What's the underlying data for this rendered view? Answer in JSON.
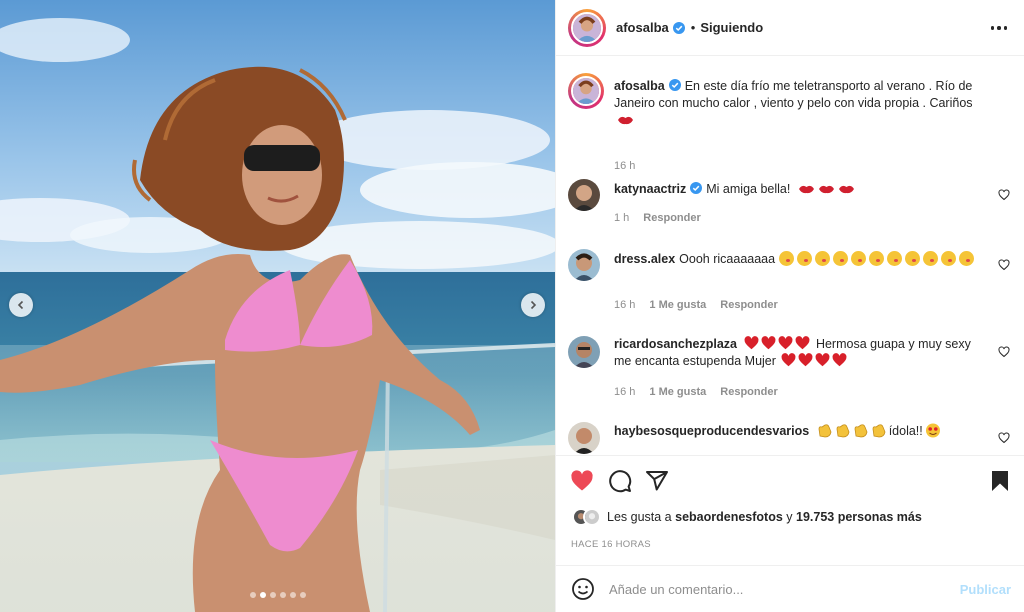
{
  "post": {
    "author": "afosalba",
    "follow_status": "Siguiendo",
    "separator": "•",
    "caption": "En este día frío me teletransporto al verano . Río de Janeiro con mucho calor , viento y pelo con vida propia . Cariños",
    "caption_time": "16 h"
  },
  "media": {
    "slides_count": 6,
    "active_slide": 2,
    "prev_icon": "chevron-left-icon",
    "next_icon": "chevron-right-icon"
  },
  "comments": [
    {
      "user": "katynaactriz",
      "verified": true,
      "text": "Mi amiga bella!",
      "time": "1 h",
      "likes": "",
      "reply": "Responder"
    },
    {
      "user": "dress.alex",
      "verified": false,
      "text": "Oooh ricaaaaaaa",
      "time": "16 h",
      "likes": "1 Me gusta",
      "reply": "Responder"
    },
    {
      "user": "ricardosanchezplaza",
      "verified": false,
      "text_a": "Hermosa guapa y muy sexy",
      "text_b": "me encanta estupenda Mujer",
      "time": "16 h",
      "likes": "1 Me gusta",
      "reply": "Responder"
    },
    {
      "user": "haybesosqueproducendesvarios",
      "verified": false,
      "text": "ídola!!"
    }
  ],
  "actions": {
    "like_icon": "heart-filled-icon",
    "comment_icon": "comment-icon",
    "share_icon": "share-icon",
    "save_icon": "bookmark-filled-icon",
    "likes_prefix": "Les gusta a",
    "likes_user": "sebaordenesfotos",
    "likes_and": "y",
    "likes_count": "19.753 personas más",
    "time_ago": "HACE 16 HORAS"
  },
  "add_comment": {
    "placeholder": "Añade un comentario...",
    "publish": "Publicar"
  },
  "colors": {
    "like_red": "#ed4956",
    "verified_blue": "#3897f0",
    "publish_disabled": "#b2dffc",
    "muted": "#8e8e8e"
  }
}
